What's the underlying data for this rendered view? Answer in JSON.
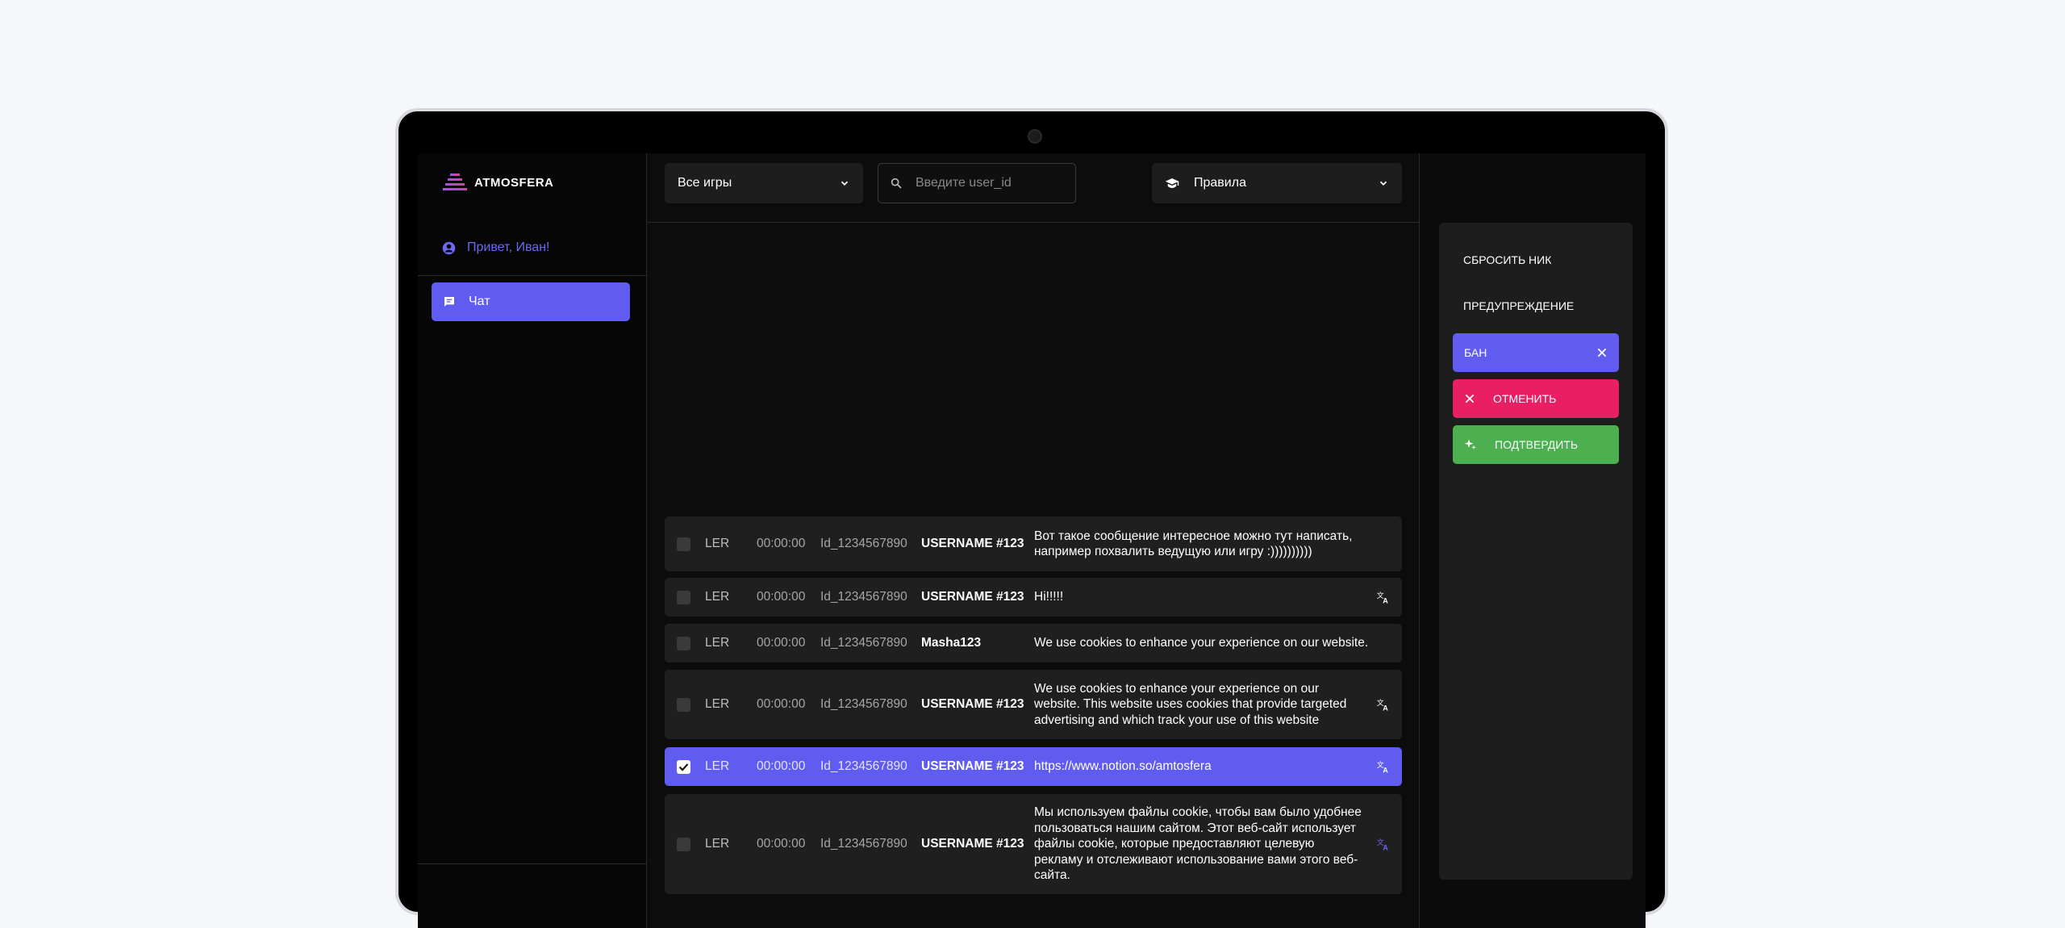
{
  "app": {
    "logo_text": "ATMOSFERA"
  },
  "sidebar": {
    "greeting": "Привет, Иван!",
    "nav": [
      {
        "label": "Чат",
        "icon": "chat-icon",
        "active": true
      }
    ]
  },
  "topbar": {
    "games_select": "Все игры",
    "search_placeholder": "Введите user_id",
    "rules_select": "Правила"
  },
  "messages": [
    {
      "tag": "LER",
      "time": "00:00:00",
      "id": "Id_1234567890",
      "user": "USERNAME #123",
      "text": "Вот такое сообщение интересное можно тут написать, например похвалить ведущую или игру :))))))))))",
      "checked": false,
      "translate": false
    },
    {
      "tag": "LER",
      "time": "00:00:00",
      "id": "Id_1234567890",
      "user": "USERNAME #123",
      "text": "Hi!!!!!",
      "checked": false,
      "translate": true
    },
    {
      "tag": "LER",
      "time": "00:00:00",
      "id": "Id_1234567890",
      "user": "Masha123",
      "text": "We use cookies to enhance your experience on our website.",
      "checked": false,
      "translate": false
    },
    {
      "tag": "LER",
      "time": "00:00:00",
      "id": "Id_1234567890",
      "user": "USERNAME #123",
      "text": "We use cookies to enhance your experience on our website. This website uses cookies that provide targeted advertising and which track your use of this website",
      "checked": false,
      "translate": true
    },
    {
      "tag": "LER",
      "time": "00:00:00",
      "id": "Id_1234567890",
      "user": "USERNAME #123",
      "text": "https://www.notion.so/amtosfera",
      "checked": true,
      "translate": true
    },
    {
      "tag": "LER",
      "time": "00:00:00",
      "id": "Id_1234567890",
      "user": "USERNAME #123",
      "text": "Мы используем файлы cookie, чтобы вам было удобнее пользоваться нашим сайтом. Этот веб-сайт использует файлы cookie, которые предоставляют целевую рекламу и отслеживают использование вами этого веб-сайта.",
      "checked": false,
      "translate": true
    }
  ],
  "actions": {
    "reset_nick": "СБРОСИТЬ НИК",
    "warning": "ПРЕДУПРЕЖДЕНИЕ",
    "ban": "БАН",
    "cancel": "ОТМЕНИТЬ",
    "confirm": "ПОДТВЕРДИТЬ"
  },
  "colors": {
    "accent": "#615cf0",
    "danger": "#e91e63",
    "success": "#4caf50"
  }
}
